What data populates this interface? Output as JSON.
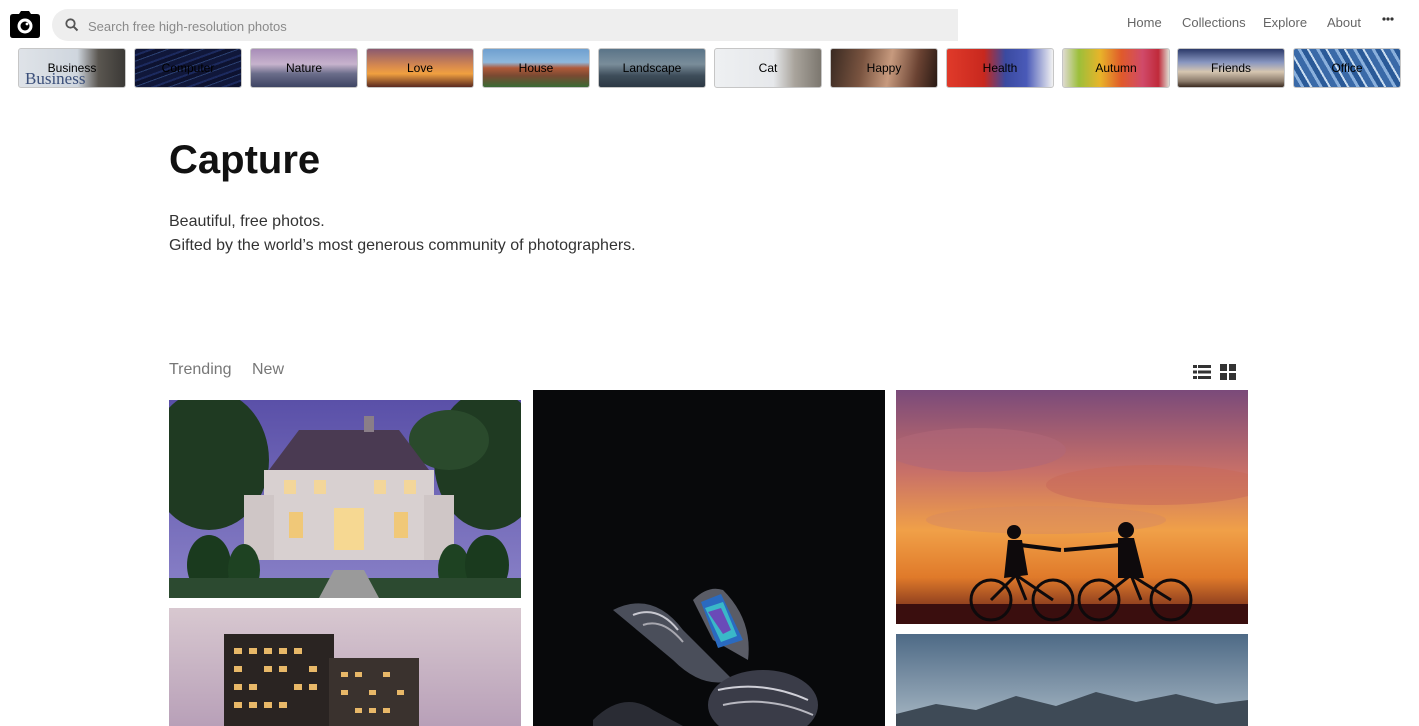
{
  "search": {
    "placeholder": "Search free high-resolution photos"
  },
  "nav": {
    "home": "Home",
    "collections": "Collections",
    "explore": "Explore",
    "about": "About"
  },
  "categories": [
    {
      "label": "Business"
    },
    {
      "label": "Computer"
    },
    {
      "label": "Nature"
    },
    {
      "label": "Love"
    },
    {
      "label": "House"
    },
    {
      "label": "Landscape"
    },
    {
      "label": "Cat"
    },
    {
      "label": "Happy"
    },
    {
      "label": "Health"
    },
    {
      "label": "Autumn"
    },
    {
      "label": "Friends"
    },
    {
      "label": "Office"
    }
  ],
  "category_decor": {
    "business_wordmark": "Business"
  },
  "hero": {
    "title": "Capture",
    "tagline_1": "Beautiful, free photos.",
    "tagline_2": "Gifted by the world’s most generous community of photographers."
  },
  "tabs": {
    "trending": "Trending",
    "new": "New"
  },
  "icons": {
    "logo": "camera-icon",
    "search": "search-icon",
    "more": "more-dots-icon",
    "list_view": "list-view-icon",
    "grid_view": "grid-view-icon"
  },
  "colors": {
    "nav_text": "#666666",
    "search_bg": "#eeeeee",
    "tab_text": "#777777"
  }
}
